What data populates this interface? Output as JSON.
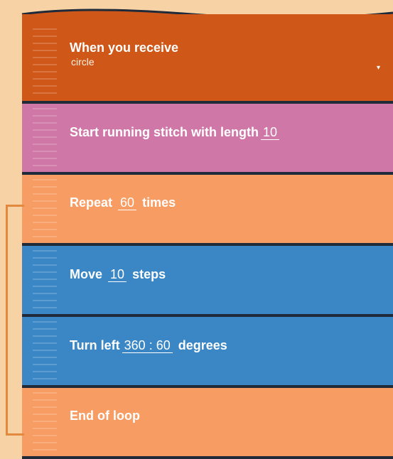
{
  "blocks": {
    "receive": {
      "title": "When you receive",
      "value": "circle",
      "color": "#cf5718"
    },
    "stitch": {
      "prefix": "Start running stitch with length",
      "value": "10",
      "color": "#cf78a7"
    },
    "repeat": {
      "prefix": "Repeat",
      "value": "60",
      "suffix": "times",
      "color": "#f79c63"
    },
    "move": {
      "prefix": "Move",
      "value": "10",
      "suffix": "steps",
      "color": "#3b87c6"
    },
    "turn": {
      "prefix": "Turn left",
      "value": "360 : 60",
      "suffix": "degrees",
      "color": "#3b87c6"
    },
    "end": {
      "title": "End of loop",
      "color": "#f79c63"
    }
  },
  "icons": {
    "dropdown": "caret-down-icon"
  },
  "colors": {
    "background": "#f7d2a4",
    "loop_bracket": "#e3893d",
    "separator": "#1f2a3a"
  }
}
